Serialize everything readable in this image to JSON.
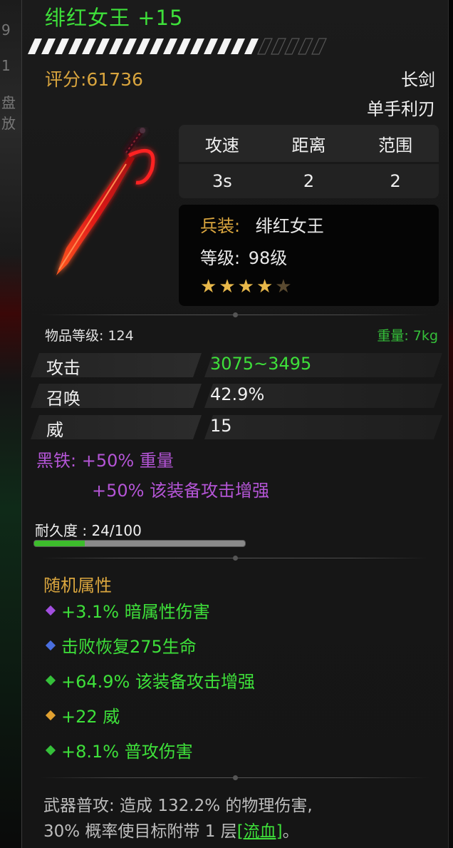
{
  "item": {
    "title": "绯红女王 +15",
    "score": "评分:61736",
    "weapon_type": "长剑",
    "weapon_class": "单手利刃",
    "enhance_progress": 0.75
  },
  "stats_table": {
    "headers": [
      "攻速",
      "距离",
      "范围"
    ],
    "values": [
      "3s",
      "2",
      "2"
    ]
  },
  "info": {
    "soldier_label": "兵装:",
    "soldier_value": "绯红女王",
    "level_label": "等级:",
    "level_value": "98级",
    "stars_filled": 4,
    "stars_total": 5
  },
  "item_level": "物品等级: 124",
  "weight": "重量: 7kg",
  "attributes": [
    {
      "label": "攻击",
      "value": "3075~3495",
      "value_color": "#3ee03a"
    },
    {
      "label": "召唤",
      "value": "42.9%",
      "value_color": "#f0f0f0"
    },
    {
      "label": "威",
      "value": "15",
      "value_color": "#f0f0f0"
    }
  ],
  "material": {
    "line1": "黑铁: +50% 重量",
    "line2": "+50% 该装备攻击增强"
  },
  "durability": {
    "label": "耐久度 : 24/100",
    "fraction": 0.24
  },
  "random": {
    "title": "随机属性",
    "items": [
      {
        "text": "+3.1% 暗属性伤害",
        "gem_color": "#a24fe0"
      },
      {
        "text": "击败恢复275生命",
        "gem_color": "#4a6fe0"
      },
      {
        "text": "+64.9% 该装备攻击增强",
        "gem_color": "#35c03a"
      },
      {
        "text": "+22 威",
        "gem_color": "#e0a030"
      },
      {
        "text": "+8.1% 普攻伤害",
        "gem_color": "#35c03a"
      }
    ]
  },
  "description": {
    "line1": "武器普攻: 造成 132.2% 的物理伤害,",
    "line2_pre": "30% 概率使目标附带 1 层",
    "link": "[流血]",
    "line2_post": "。"
  },
  "background": {
    "frag1": "9",
    "frag2": "1",
    "frag3": "盘放"
  }
}
